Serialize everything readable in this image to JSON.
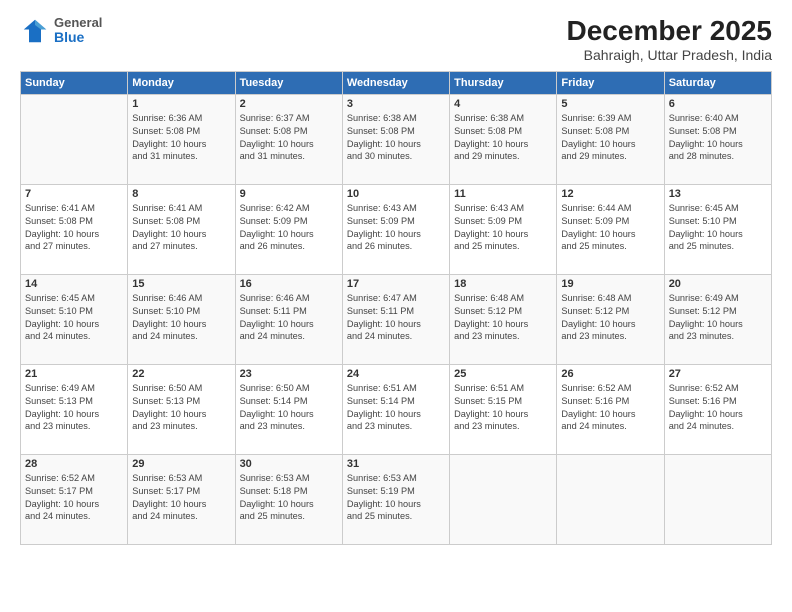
{
  "header": {
    "logo_general": "General",
    "logo_blue": "Blue",
    "month_title": "December 2025",
    "location": "Bahraigh, Uttar Pradesh, India"
  },
  "days_of_week": [
    "Sunday",
    "Monday",
    "Tuesday",
    "Wednesday",
    "Thursday",
    "Friday",
    "Saturday"
  ],
  "weeks": [
    [
      {
        "day": "",
        "content": ""
      },
      {
        "day": "1",
        "content": "Sunrise: 6:36 AM\nSunset: 5:08 PM\nDaylight: 10 hours\nand 31 minutes."
      },
      {
        "day": "2",
        "content": "Sunrise: 6:37 AM\nSunset: 5:08 PM\nDaylight: 10 hours\nand 31 minutes."
      },
      {
        "day": "3",
        "content": "Sunrise: 6:38 AM\nSunset: 5:08 PM\nDaylight: 10 hours\nand 30 minutes."
      },
      {
        "day": "4",
        "content": "Sunrise: 6:38 AM\nSunset: 5:08 PM\nDaylight: 10 hours\nand 29 minutes."
      },
      {
        "day": "5",
        "content": "Sunrise: 6:39 AM\nSunset: 5:08 PM\nDaylight: 10 hours\nand 29 minutes."
      },
      {
        "day": "6",
        "content": "Sunrise: 6:40 AM\nSunset: 5:08 PM\nDaylight: 10 hours\nand 28 minutes."
      }
    ],
    [
      {
        "day": "7",
        "content": "Sunrise: 6:41 AM\nSunset: 5:08 PM\nDaylight: 10 hours\nand 27 minutes."
      },
      {
        "day": "8",
        "content": "Sunrise: 6:41 AM\nSunset: 5:08 PM\nDaylight: 10 hours\nand 27 minutes."
      },
      {
        "day": "9",
        "content": "Sunrise: 6:42 AM\nSunset: 5:09 PM\nDaylight: 10 hours\nand 26 minutes."
      },
      {
        "day": "10",
        "content": "Sunrise: 6:43 AM\nSunset: 5:09 PM\nDaylight: 10 hours\nand 26 minutes."
      },
      {
        "day": "11",
        "content": "Sunrise: 6:43 AM\nSunset: 5:09 PM\nDaylight: 10 hours\nand 25 minutes."
      },
      {
        "day": "12",
        "content": "Sunrise: 6:44 AM\nSunset: 5:09 PM\nDaylight: 10 hours\nand 25 minutes."
      },
      {
        "day": "13",
        "content": "Sunrise: 6:45 AM\nSunset: 5:10 PM\nDaylight: 10 hours\nand 25 minutes."
      }
    ],
    [
      {
        "day": "14",
        "content": "Sunrise: 6:45 AM\nSunset: 5:10 PM\nDaylight: 10 hours\nand 24 minutes."
      },
      {
        "day": "15",
        "content": "Sunrise: 6:46 AM\nSunset: 5:10 PM\nDaylight: 10 hours\nand 24 minutes."
      },
      {
        "day": "16",
        "content": "Sunrise: 6:46 AM\nSunset: 5:11 PM\nDaylight: 10 hours\nand 24 minutes."
      },
      {
        "day": "17",
        "content": "Sunrise: 6:47 AM\nSunset: 5:11 PM\nDaylight: 10 hours\nand 24 minutes."
      },
      {
        "day": "18",
        "content": "Sunrise: 6:48 AM\nSunset: 5:12 PM\nDaylight: 10 hours\nand 23 minutes."
      },
      {
        "day": "19",
        "content": "Sunrise: 6:48 AM\nSunset: 5:12 PM\nDaylight: 10 hours\nand 23 minutes."
      },
      {
        "day": "20",
        "content": "Sunrise: 6:49 AM\nSunset: 5:12 PM\nDaylight: 10 hours\nand 23 minutes."
      }
    ],
    [
      {
        "day": "21",
        "content": "Sunrise: 6:49 AM\nSunset: 5:13 PM\nDaylight: 10 hours\nand 23 minutes."
      },
      {
        "day": "22",
        "content": "Sunrise: 6:50 AM\nSunset: 5:13 PM\nDaylight: 10 hours\nand 23 minutes."
      },
      {
        "day": "23",
        "content": "Sunrise: 6:50 AM\nSunset: 5:14 PM\nDaylight: 10 hours\nand 23 minutes."
      },
      {
        "day": "24",
        "content": "Sunrise: 6:51 AM\nSunset: 5:14 PM\nDaylight: 10 hours\nand 23 minutes."
      },
      {
        "day": "25",
        "content": "Sunrise: 6:51 AM\nSunset: 5:15 PM\nDaylight: 10 hours\nand 23 minutes."
      },
      {
        "day": "26",
        "content": "Sunrise: 6:52 AM\nSunset: 5:16 PM\nDaylight: 10 hours\nand 24 minutes."
      },
      {
        "day": "27",
        "content": "Sunrise: 6:52 AM\nSunset: 5:16 PM\nDaylight: 10 hours\nand 24 minutes."
      }
    ],
    [
      {
        "day": "28",
        "content": "Sunrise: 6:52 AM\nSunset: 5:17 PM\nDaylight: 10 hours\nand 24 minutes."
      },
      {
        "day": "29",
        "content": "Sunrise: 6:53 AM\nSunset: 5:17 PM\nDaylight: 10 hours\nand 24 minutes."
      },
      {
        "day": "30",
        "content": "Sunrise: 6:53 AM\nSunset: 5:18 PM\nDaylight: 10 hours\nand 25 minutes."
      },
      {
        "day": "31",
        "content": "Sunrise: 6:53 AM\nSunset: 5:19 PM\nDaylight: 10 hours\nand 25 minutes."
      },
      {
        "day": "",
        "content": ""
      },
      {
        "day": "",
        "content": ""
      },
      {
        "day": "",
        "content": ""
      }
    ]
  ]
}
